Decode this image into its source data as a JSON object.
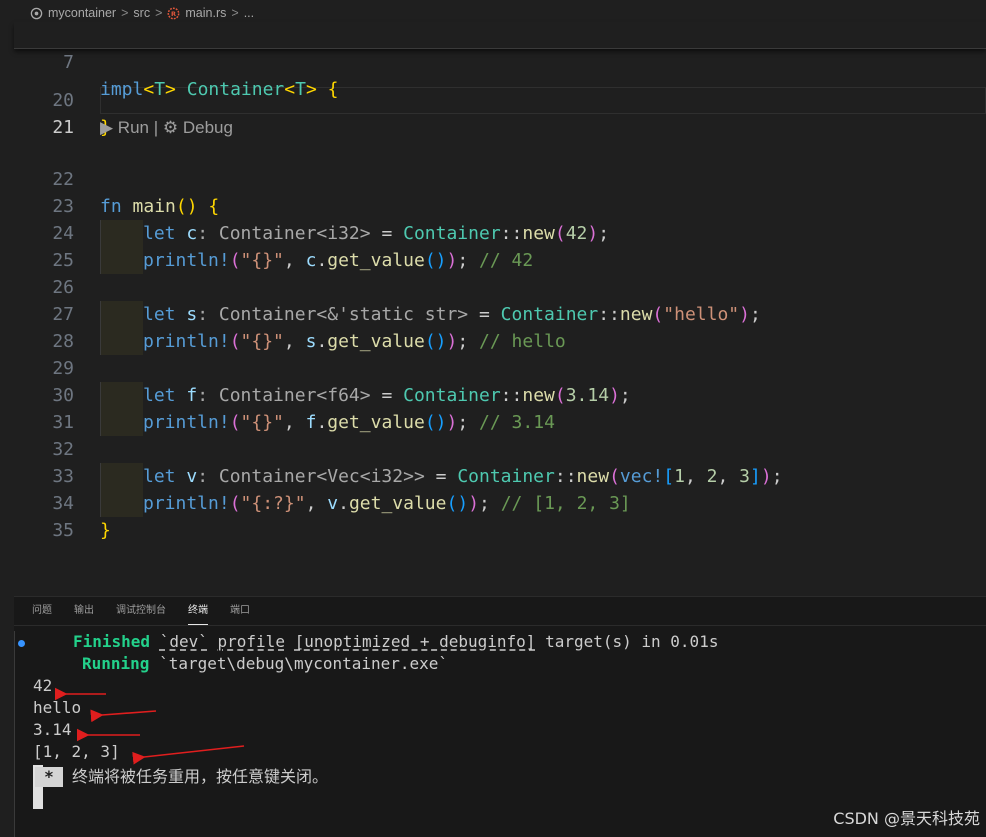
{
  "breadcrumb": {
    "items": [
      "mycontainer",
      "src",
      "main.rs",
      "..."
    ],
    "separator": ">"
  },
  "editor": {
    "lens": {
      "run": "Run",
      "divider": "|",
      "debug": "Debug"
    },
    "sticky": {
      "line": "7",
      "code": "impl<T> Container<T> {"
    },
    "lines": [
      {
        "n": "20"
      },
      {
        "n": "21"
      },
      {
        "n": "22"
      },
      {
        "n": "23"
      },
      {
        "n": "24"
      },
      {
        "n": "25"
      },
      {
        "n": "26"
      },
      {
        "n": "27"
      },
      {
        "n": "28"
      },
      {
        "n": "29"
      },
      {
        "n": "30"
      },
      {
        "n": "31"
      },
      {
        "n": "32"
      },
      {
        "n": "33"
      },
      {
        "n": "34"
      },
      {
        "n": "35"
      }
    ],
    "code": {
      "l20": "}",
      "l22_kw": "fn",
      "l22_fn": "main",
      "l22_rest": "() {",
      "l23": "let c: Container<i32> = Container::new(42);",
      "l24": "println!(\"{}\", c.get_value()); // 42",
      "l26": "let s: Container<&'static str> = Container::new(\"hello\");",
      "l27": "println!(\"{}\", s.get_value()); // hello",
      "l29": "let f: Container<f64> = Container::new(3.14);",
      "l30": "println!(\"{}\", f.get_value()); // 3.14",
      "l32": "let v: Container<Vec<i32>> = Container::new(vec![1, 2, 3]);",
      "l33": "println!(\"{:?}\", v.get_value()); // [1, 2, 3]",
      "l34": "}"
    }
  },
  "panel": {
    "tabs": [
      "问题",
      "输出",
      "调试控制台",
      "终端",
      "端口"
    ],
    "active_tab": "终端",
    "terminal": {
      "finished_label": "Finished",
      "finished_rest_1": "`dev`",
      "finished_rest_2": "profile",
      "finished_rest_3": "[unoptimized + debuginfo]",
      "finished_rest_4": "target(s) in 0.01s",
      "running_label": "Running",
      "running_rest": "`target\\debug\\mycontainer.exe`",
      "output": [
        "42",
        "hello",
        "3.14",
        "[1, 2, 3]"
      ],
      "reuse_star": "*",
      "reuse_message": "终端将被任务重用，按任意键关闭。"
    }
  },
  "watermark": "CSDN @景天科技苑",
  "colors": {
    "background": "#1f1f1f",
    "keyword": "#569cd6",
    "type": "#4ec9b0",
    "function": "#dcdcaa",
    "string": "#ce9178",
    "number": "#b5cea8",
    "comment": "#6a9955",
    "terminal_ok": "#23d18b",
    "arrow": "#e01e1e"
  }
}
